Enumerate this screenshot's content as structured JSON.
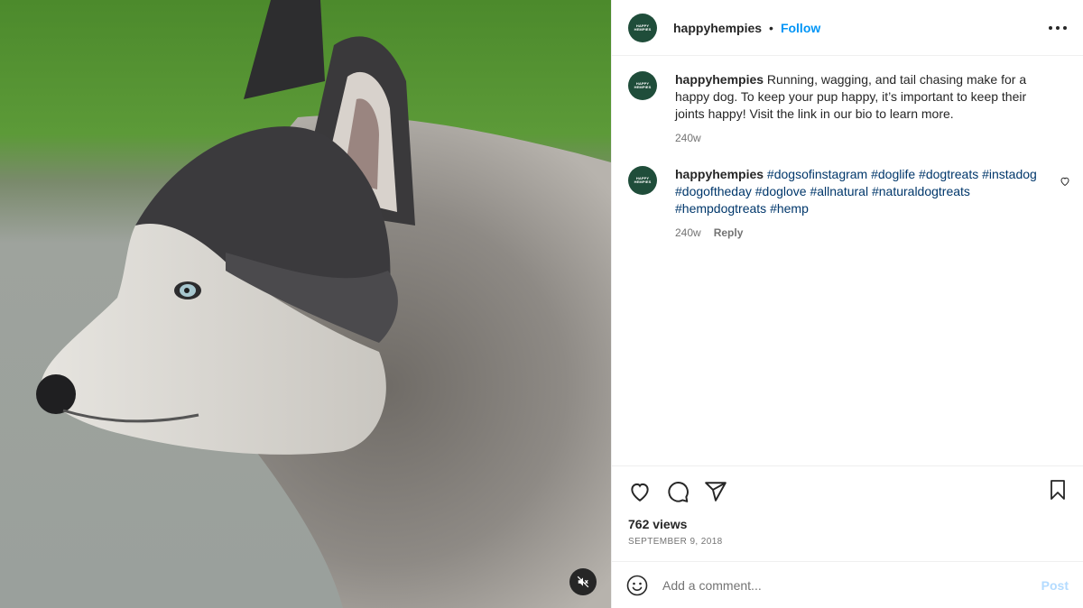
{
  "media": {
    "description_icon": "mute-icon"
  },
  "header": {
    "username": "happyhempies",
    "separator": "•",
    "follow_label": "Follow",
    "more_icon": "more-horizontal-icon",
    "avatar_logo": "HAPPY HEMPIES"
  },
  "comments": [
    {
      "username": "happyhempies",
      "text": "Running, wagging, and tail chasing make for a happy dog. To keep your pup happy, it’s important to keep their joints happy! Visit the link in our bio to learn more.",
      "age": "240w"
    },
    {
      "username": "happyhempies",
      "hashtags": [
        "#dogsofinstagram",
        "#doglife",
        "#dogtreats",
        "#instadog",
        "#dogoftheday",
        "#doglove",
        "#allnatural",
        "#naturaldogtreats",
        "#hempdogtreats",
        "#hemp"
      ],
      "age": "240w",
      "reply_label": "Reply"
    }
  ],
  "actions": {
    "icons": [
      "heart-icon",
      "comment-icon",
      "share-icon",
      "bookmark-icon"
    ],
    "views": "762 views",
    "date": "September 9, 2018"
  },
  "add_comment": {
    "placeholder": "Add a comment...",
    "post_label": "Post"
  },
  "colors": {
    "accent": "#0095f6",
    "hashtag": "#00376b",
    "avatar_bg": "#1f4d3a",
    "post_disabled": "#b3dbff"
  }
}
